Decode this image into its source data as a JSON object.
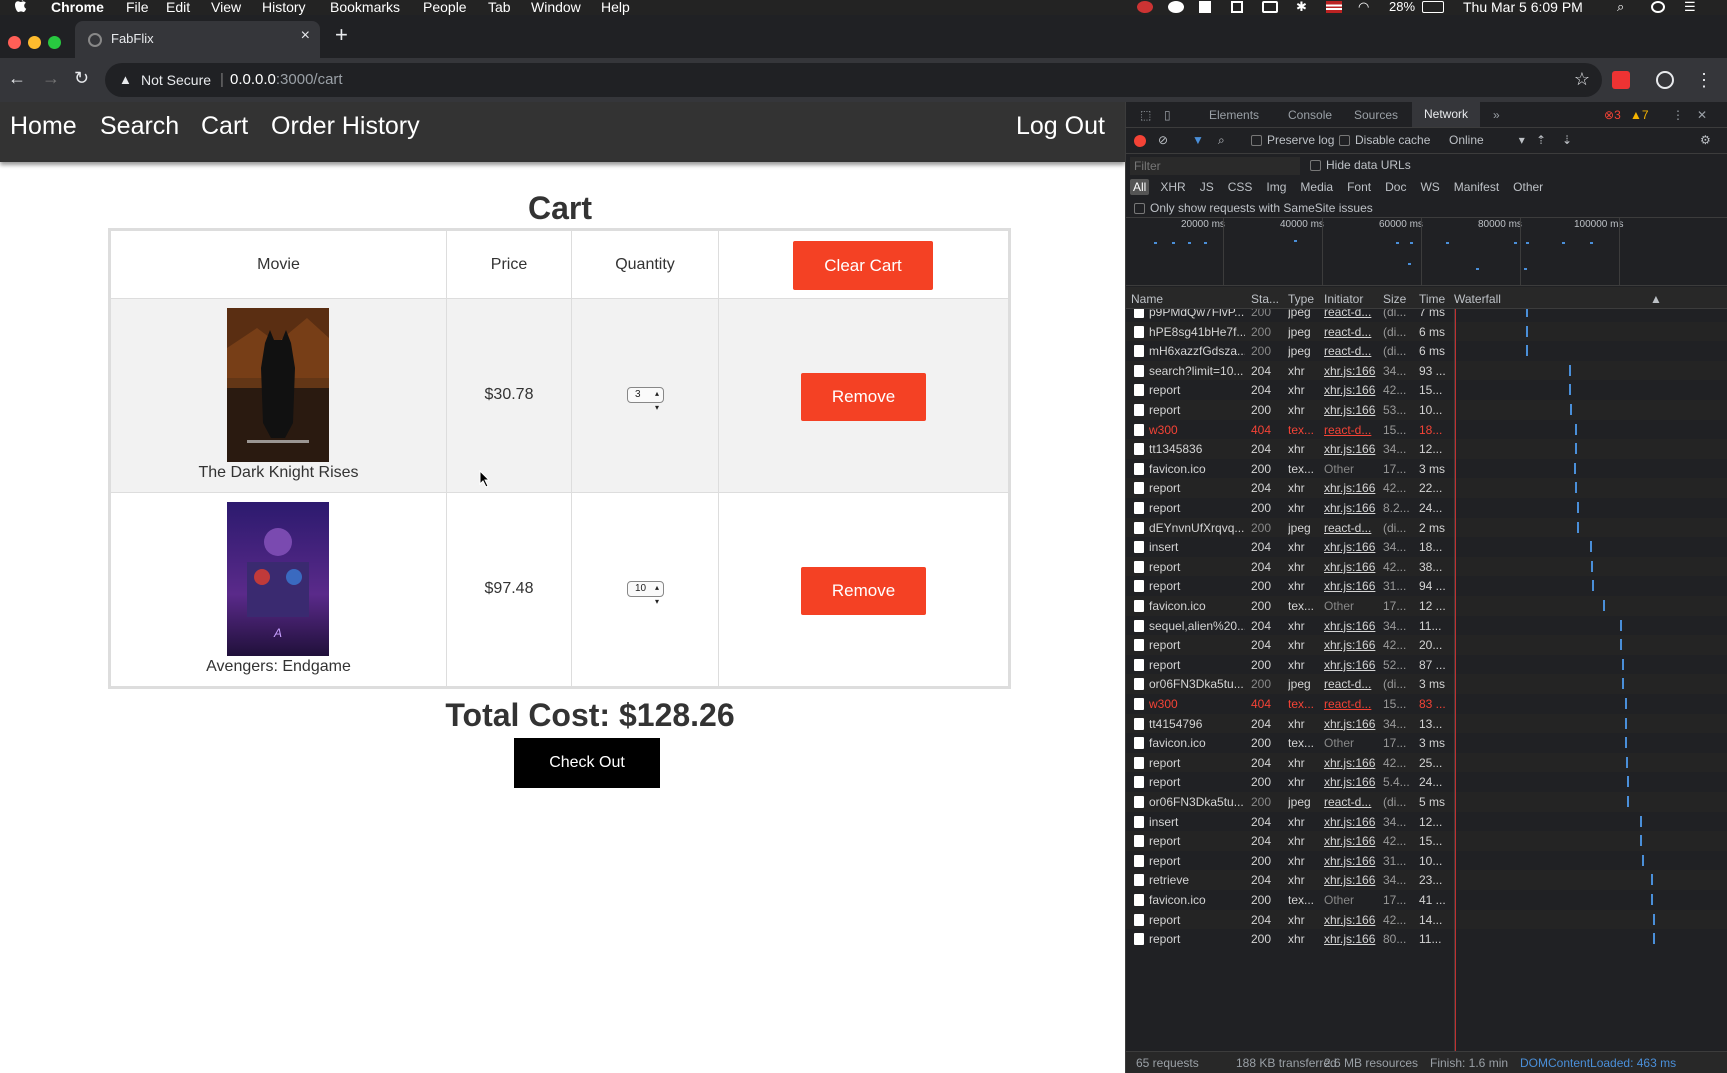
{
  "menubar": {
    "app": "Chrome",
    "items": [
      "File",
      "Edit",
      "View",
      "History",
      "Bookmarks",
      "People",
      "Tab",
      "Window",
      "Help"
    ],
    "battery": "28%",
    "datetime": "Thu Mar 5  6:09 PM"
  },
  "browser": {
    "tab_title": "FabFlix",
    "security": "Not Secure",
    "url_host": "0.0.0.0",
    "url_rest": ":3000/cart"
  },
  "app_nav": {
    "home": "Home",
    "search": "Search",
    "cart": "Cart",
    "order_history": "Order History",
    "logout": "Log Out"
  },
  "cart": {
    "title": "Cart",
    "headers": {
      "movie": "Movie",
      "price": "Price",
      "quantity": "Quantity"
    },
    "clear_label": "Clear Cart",
    "items": [
      {
        "title": "The Dark Knight Rises",
        "price": "$30.78",
        "quantity": "3",
        "remove": "Remove"
      },
      {
        "title": "Avengers: Endgame",
        "price": "$97.48",
        "quantity": "10",
        "remove": "Remove"
      }
    ],
    "total": "Total Cost: $128.26",
    "checkout": "Check Out"
  },
  "devtools": {
    "tabs": [
      "Elements",
      "Console",
      "Sources",
      "Network"
    ],
    "active": "Network",
    "errors": "3",
    "warnings": "7",
    "preserve": "Preserve log",
    "disable_cache": "Disable cache",
    "throttle": "Online",
    "filter_placeholder": "Filter",
    "hide_data": "Hide data URLs",
    "types": [
      "All",
      "XHR",
      "JS",
      "CSS",
      "Img",
      "Media",
      "Font",
      "Doc",
      "WS",
      "Manifest",
      "Other"
    ],
    "samesite": "Only show requests with SameSite issues",
    "ticks": [
      "20000 ms",
      "40000 ms",
      "60000 ms",
      "80000 ms",
      "100000 ms"
    ],
    "columns": [
      "Name",
      "Sta...",
      "Type",
      "Initiator",
      "Size",
      "Time",
      "Waterfall"
    ],
    "rows": [
      {
        "name": "p9PMdQw7FlvP...",
        "status": "200",
        "type": "jpeg",
        "init": "react-d...",
        "size": "(di...",
        "time": "7 ms"
      },
      {
        "name": "hPE8sg41bHe7f...",
        "status": "200",
        "type": "jpeg",
        "init": "react-d...",
        "size": "(di...",
        "time": "6 ms"
      },
      {
        "name": "mH6xazzfGdsza...",
        "status": "200",
        "type": "jpeg",
        "init": "react-d...",
        "size": "(di...",
        "time": "6 ms"
      },
      {
        "name": "search?limit=10...",
        "status": "204",
        "type": "xhr",
        "init": "xhr.js:166",
        "size": "34...",
        "time": "93 ..."
      },
      {
        "name": "report",
        "status": "204",
        "type": "xhr",
        "init": "xhr.js:166",
        "size": "42...",
        "time": "15..."
      },
      {
        "name": "report",
        "status": "200",
        "type": "xhr",
        "init": "xhr.js:166",
        "size": "53...",
        "time": "10..."
      },
      {
        "name": "w300",
        "status": "404",
        "type": "tex...",
        "init": "react-d...",
        "size": "15...",
        "time": "18..."
      },
      {
        "name": "tt1345836",
        "status": "204",
        "type": "xhr",
        "init": "xhr.js:166",
        "size": "34...",
        "time": "12..."
      },
      {
        "name": "favicon.ico",
        "status": "200",
        "type": "tex...",
        "init": "Other",
        "size": "17...",
        "time": "3 ms"
      },
      {
        "name": "report",
        "status": "204",
        "type": "xhr",
        "init": "xhr.js:166",
        "size": "42...",
        "time": "22..."
      },
      {
        "name": "report",
        "status": "200",
        "type": "xhr",
        "init": "xhr.js:166",
        "size": "8.2...",
        "time": "24..."
      },
      {
        "name": "dEYnvnUfXrqvq...",
        "status": "200",
        "type": "jpeg",
        "init": "react-d...",
        "size": "(di...",
        "time": "2 ms"
      },
      {
        "name": "insert",
        "status": "204",
        "type": "xhr",
        "init": "xhr.js:166",
        "size": "34...",
        "time": "18..."
      },
      {
        "name": "report",
        "status": "204",
        "type": "xhr",
        "init": "xhr.js:166",
        "size": "42...",
        "time": "38..."
      },
      {
        "name": "report",
        "status": "200",
        "type": "xhr",
        "init": "xhr.js:166",
        "size": "31...",
        "time": "94 ..."
      },
      {
        "name": "favicon.ico",
        "status": "200",
        "type": "tex...",
        "init": "Other",
        "size": "17...",
        "time": "12 ..."
      },
      {
        "name": "sequel,alien%20...",
        "status": "204",
        "type": "xhr",
        "init": "xhr.js:166",
        "size": "34...",
        "time": "11..."
      },
      {
        "name": "report",
        "status": "204",
        "type": "xhr",
        "init": "xhr.js:166",
        "size": "42...",
        "time": "20..."
      },
      {
        "name": "report",
        "status": "200",
        "type": "xhr",
        "init": "xhr.js:166",
        "size": "52...",
        "time": "87 ..."
      },
      {
        "name": "or06FN3Dka5tu...",
        "status": "200",
        "type": "jpeg",
        "init": "react-d...",
        "size": "(di...",
        "time": "3 ms"
      },
      {
        "name": "w300",
        "status": "404",
        "type": "tex...",
        "init": "react-d...",
        "size": "15...",
        "time": "83 ..."
      },
      {
        "name": "tt4154796",
        "status": "204",
        "type": "xhr",
        "init": "xhr.js:166",
        "size": "34...",
        "time": "13..."
      },
      {
        "name": "favicon.ico",
        "status": "200",
        "type": "tex...",
        "init": "Other",
        "size": "17...",
        "time": "3 ms"
      },
      {
        "name": "report",
        "status": "204",
        "type": "xhr",
        "init": "xhr.js:166",
        "size": "42...",
        "time": "25..."
      },
      {
        "name": "report",
        "status": "200",
        "type": "xhr",
        "init": "xhr.js:166",
        "size": "5.4...",
        "time": "24..."
      },
      {
        "name": "or06FN3Dka5tu...",
        "status": "200",
        "type": "jpeg",
        "init": "react-d...",
        "size": "(di...",
        "time": "5 ms"
      },
      {
        "name": "insert",
        "status": "204",
        "type": "xhr",
        "init": "xhr.js:166",
        "size": "34...",
        "time": "12..."
      },
      {
        "name": "report",
        "status": "204",
        "type": "xhr",
        "init": "xhr.js:166",
        "size": "42...",
        "time": "15..."
      },
      {
        "name": "report",
        "status": "200",
        "type": "xhr",
        "init": "xhr.js:166",
        "size": "31...",
        "time": "10..."
      },
      {
        "name": "retrieve",
        "status": "204",
        "type": "xhr",
        "init": "xhr.js:166",
        "size": "34...",
        "time": "23..."
      },
      {
        "name": "favicon.ico",
        "status": "200",
        "type": "tex...",
        "init": "Other",
        "size": "17...",
        "time": "41 ..."
      },
      {
        "name": "report",
        "status": "204",
        "type": "xhr",
        "init": "xhr.js:166",
        "size": "42...",
        "time": "14..."
      },
      {
        "name": "report",
        "status": "200",
        "type": "xhr",
        "init": "xhr.js:166",
        "size": "80...",
        "time": "11..."
      }
    ],
    "status": {
      "requests": "65 requests",
      "transferred": "188 KB transferred",
      "resources": "2.6 MB resources",
      "finish": "Finish: 1.6 min",
      "dcl": "DOMContentLoaded: 463 ms"
    }
  },
  "colors": {
    "accent": "#f44124",
    "nav": "#333333",
    "devtools_bg": "#202124"
  }
}
